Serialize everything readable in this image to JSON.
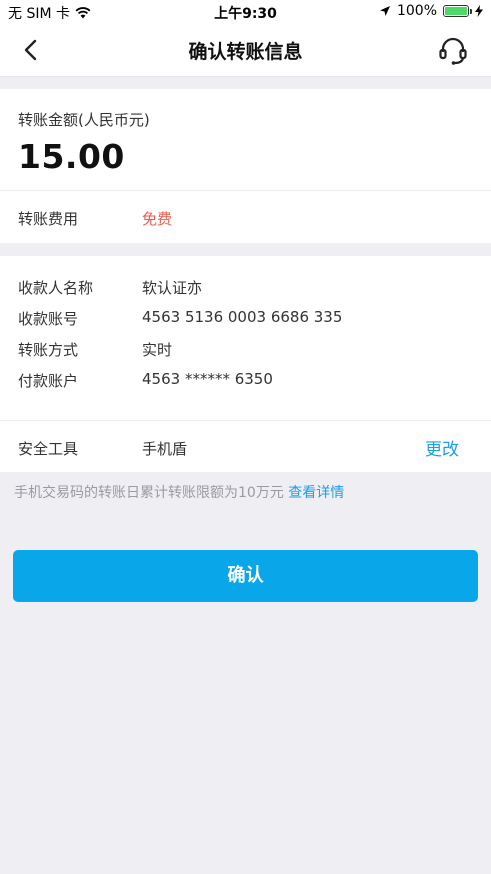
{
  "status_bar": {
    "carrier": "无 SIM 卡",
    "time": "上午9:30",
    "battery": "100%",
    "battery_level": 1.0,
    "battery_color": "#4cd964",
    "icons": [
      "wifi-icon",
      "location-arrow-icon",
      "battery-icon",
      "charging-bolt-icon"
    ]
  },
  "nav": {
    "title": "确认转账信息",
    "back_icon": "chevron-left-icon",
    "service_icon": "headset-icon"
  },
  "amount": {
    "label": "转账金额(人民币元)",
    "value": "15.00"
  },
  "fee": {
    "label": "转账费用",
    "value": "免费",
    "value_color": "#f05a4f"
  },
  "details": [
    {
      "label": "收款人名称",
      "value": "软认证亦"
    },
    {
      "label": "收款账号",
      "value": "4563 5136 0003 6686 335"
    },
    {
      "label": "转账方式",
      "value": "实时"
    },
    {
      "label": "付款账户",
      "value": "4563 ****** 6350"
    }
  ],
  "security": {
    "label": "安全工具",
    "value": "手机盾",
    "change_label": "更改"
  },
  "notice": {
    "text": "手机交易码的转账日累计转账限额为10万元",
    "link": "查看详情"
  },
  "confirm_button": {
    "label": "确认",
    "color": "#0aa6ea"
  },
  "accent_color": "#1aa0e8"
}
